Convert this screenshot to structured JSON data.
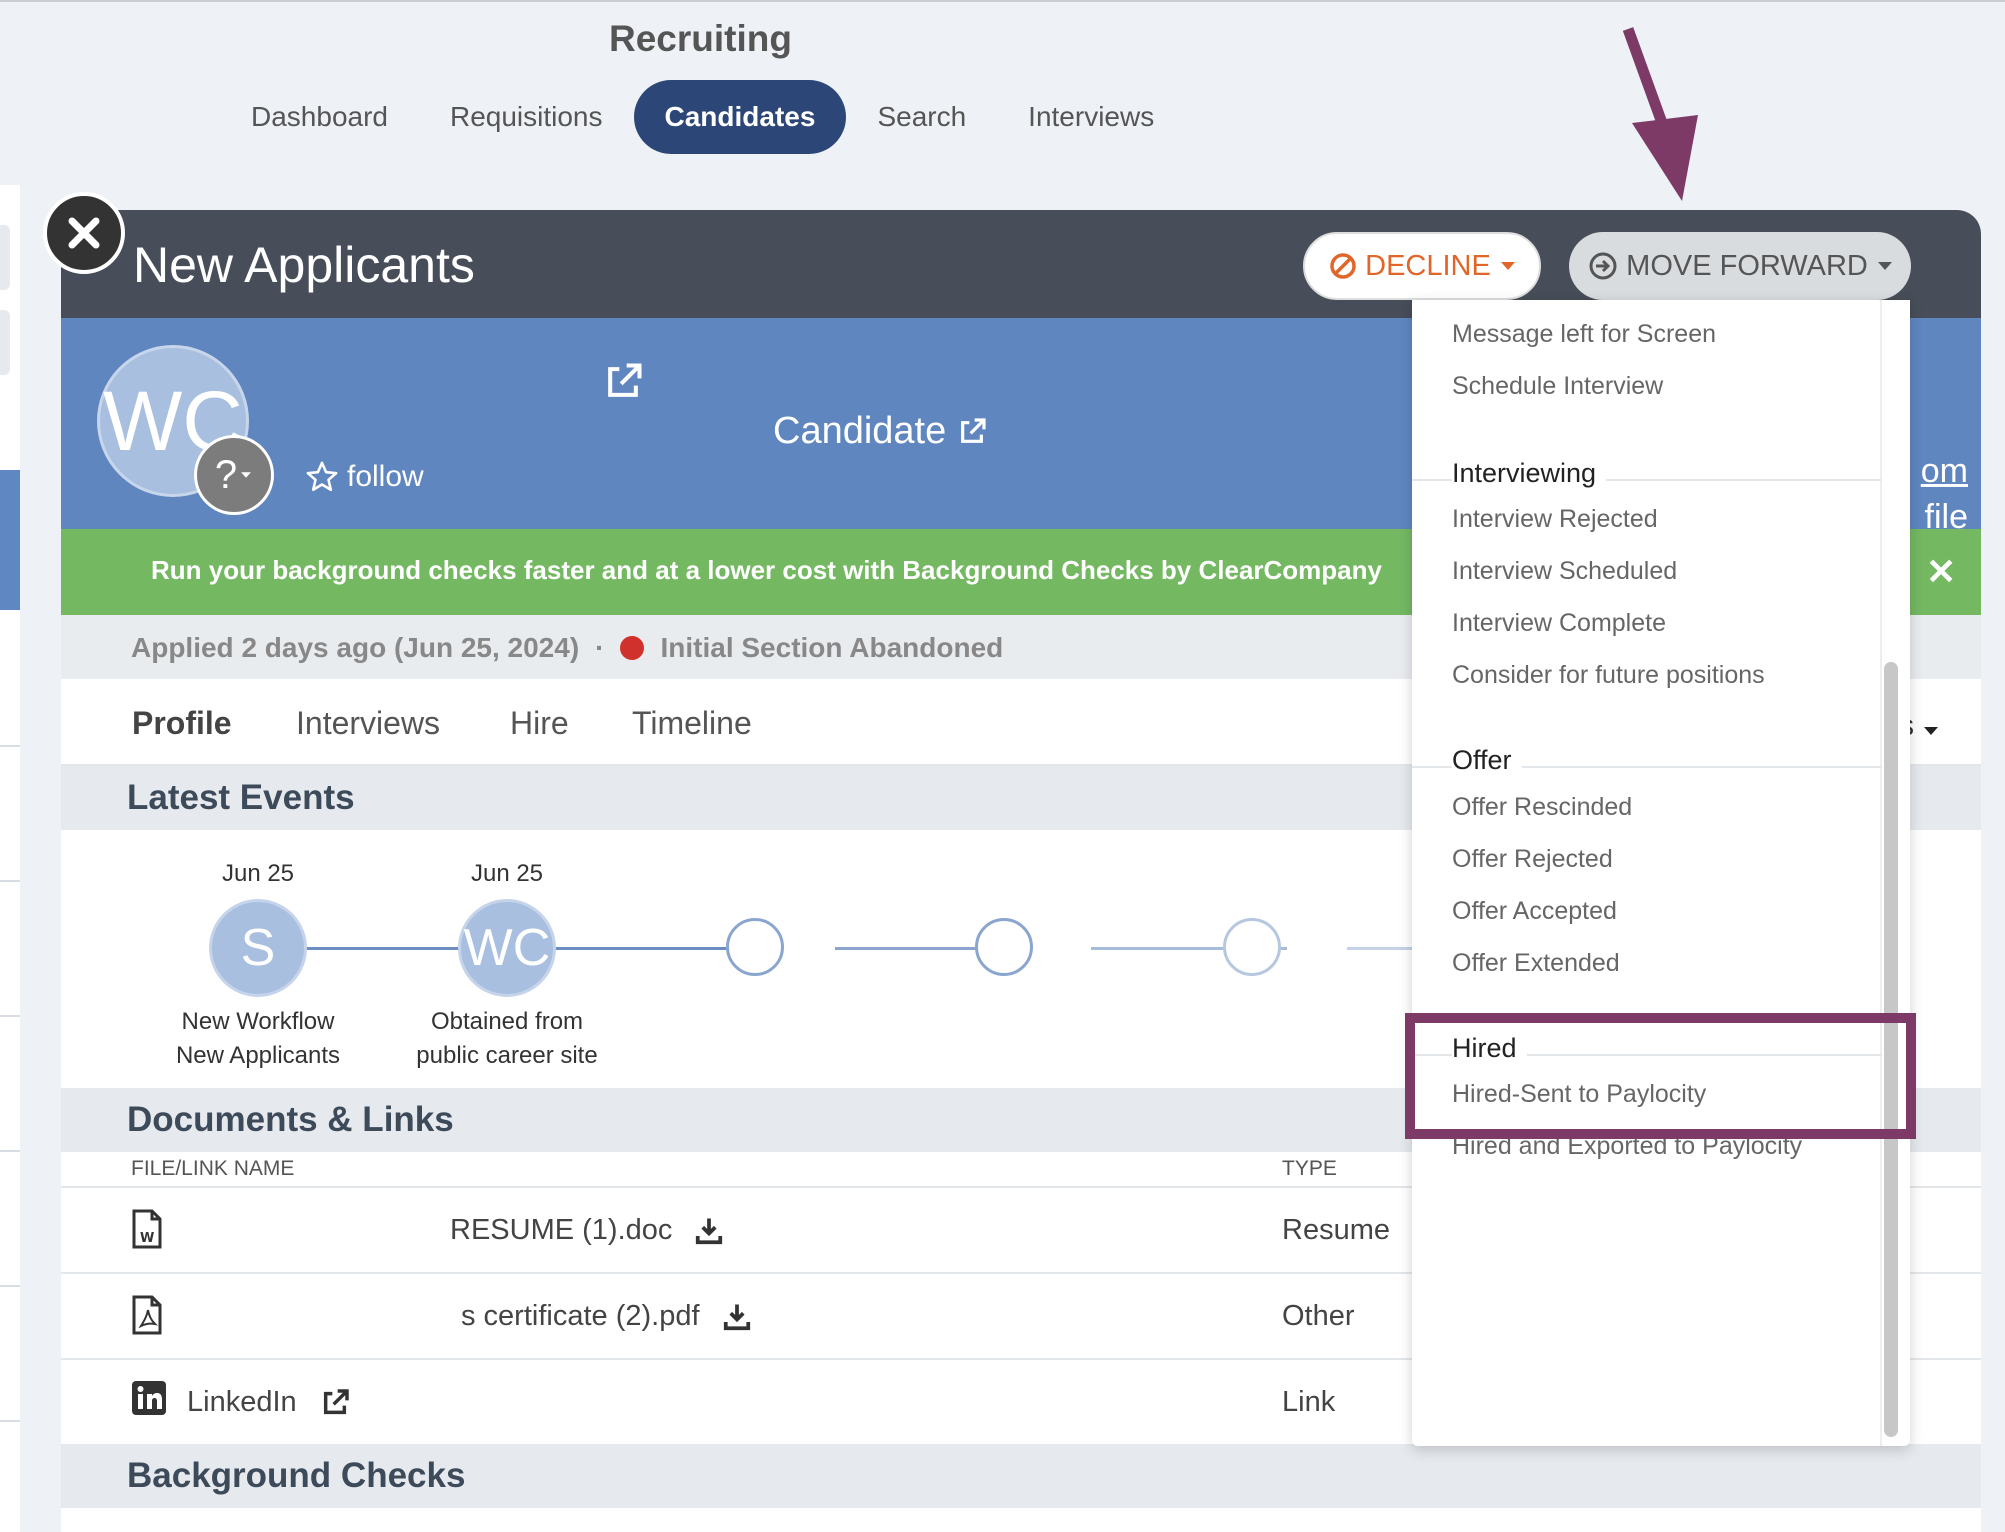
{
  "app": {
    "title": "Recruiting"
  },
  "nav": {
    "tabs": [
      "Dashboard",
      "Requisitions",
      "Candidates",
      "Search",
      "Interviews"
    ],
    "active": "Candidates"
  },
  "modal": {
    "title": "New Applicants",
    "decline_label": "DECLINE",
    "move_forward_label": "MOVE FORWARD"
  },
  "candidate": {
    "initials": "WC",
    "badge": "?",
    "follow_label": "follow",
    "name_label": "Candidate",
    "right_peek": [
      "om",
      "file"
    ]
  },
  "promo": {
    "text": "Run your background checks faster and at a lower cost with Background Checks by ClearCompany"
  },
  "status": {
    "applied": "Applied 2 days ago (Jun 25, 2024)",
    "separator": "·",
    "state": "Initial Section Abandoned",
    "state_color": "#d0312d"
  },
  "subtabs": [
    "Profile",
    "Interviews",
    "Hire",
    "Timeline"
  ],
  "subtabs_right": "s",
  "latest_events": {
    "heading": "Latest Events",
    "events": [
      {
        "date": "Jun 25",
        "initials": "S",
        "caption_1": "New Workflow",
        "caption_2": "New Applicants"
      },
      {
        "date": "Jun 25",
        "initials": "WC",
        "caption_1": "Obtained from",
        "caption_2": "public career site"
      }
    ]
  },
  "documents": {
    "heading": "Documents & Links",
    "col_name": "FILE/LINK NAME",
    "col_type": "TYPE",
    "rows": [
      {
        "icon": "word-doc-icon",
        "name": "RESUME (1).doc",
        "type": "Resume"
      },
      {
        "icon": "pdf-icon",
        "name": "s certificate (2).pdf",
        "type": "Other"
      },
      {
        "icon": "linkedin-icon",
        "name": "LinkedIn",
        "type": "Link"
      }
    ]
  },
  "background_checks": {
    "heading": "Background Checks"
  },
  "dropdown": {
    "top_items": [
      "Message left for Screen",
      "Schedule Interview"
    ],
    "groups": [
      {
        "header": "Interviewing",
        "items": [
          "Interview Rejected",
          "Interview Scheduled",
          "Interview Complete",
          "Consider for future positions"
        ]
      },
      {
        "header": "Offer",
        "items": [
          "Offer Rescinded",
          "Offer Rejected",
          "Offer Accepted",
          "Offer Extended"
        ]
      },
      {
        "header": "Hired",
        "items": [
          "Hired-Sent to Paylocity",
          "Hired and Exported to Paylocity"
        ]
      }
    ]
  },
  "colors": {
    "nav_active": "#2c4777",
    "header": "#474e59",
    "band": "#6086c0",
    "promo": "#74b862",
    "annotation": "#7d3a66",
    "decline": "#e0662a"
  }
}
